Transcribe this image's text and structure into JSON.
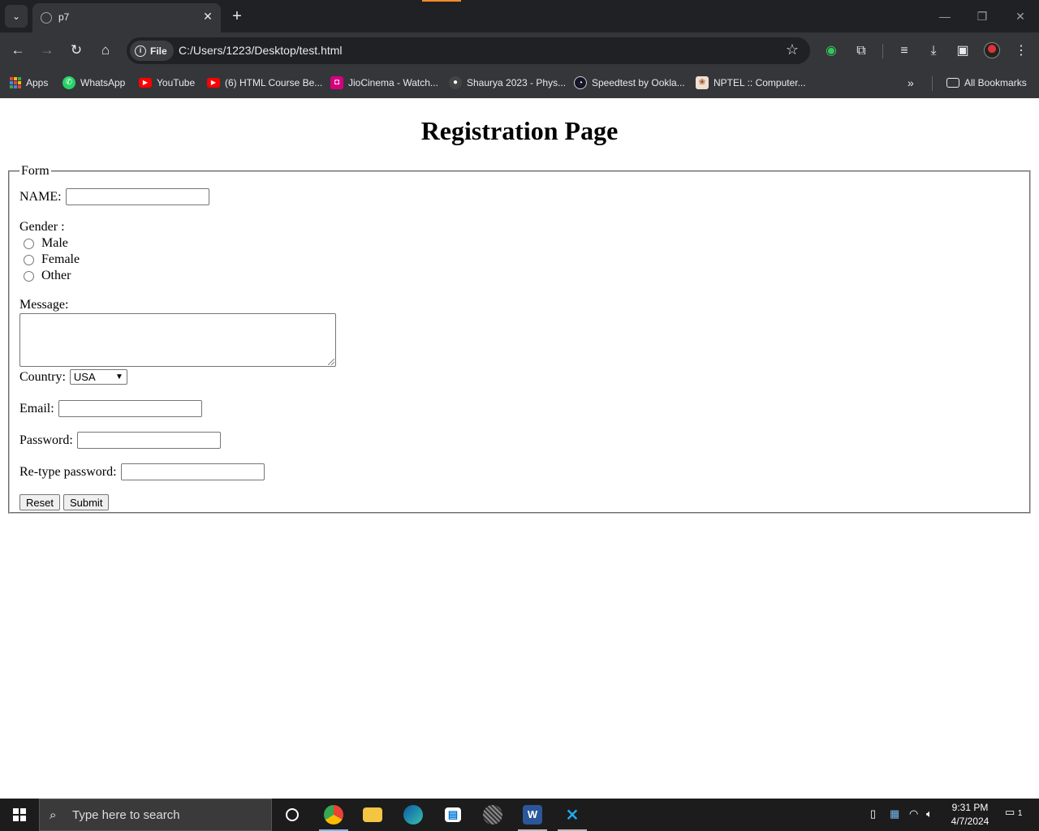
{
  "browser": {
    "tab_title": "p7",
    "address_chip": "File",
    "url": "C:/Users/1223/Desktop/test.html",
    "bookmarks": [
      {
        "label": "Apps",
        "icon": "apps-grid-icon"
      },
      {
        "label": "WhatsApp",
        "icon": "whatsapp-icon",
        "color": "#25d366"
      },
      {
        "label": "YouTube",
        "icon": "youtube-icon",
        "color": "#ff0000"
      },
      {
        "label": "(6) HTML Course Be...",
        "icon": "youtube-icon",
        "color": "#ff0000"
      },
      {
        "label": "JioCinema - Watch...",
        "icon": "jiocinema-icon",
        "color": "#d6007e"
      },
      {
        "label": "Shaurya 2023 - Phys...",
        "icon": "site-icon",
        "color": "#444444"
      },
      {
        "label": "Speedtest by Ookla...",
        "icon": "speedtest-icon",
        "color": "#141526"
      },
      {
        "label": "NPTEL :: Computer...",
        "icon": "nptel-icon",
        "color": "#f0e0d0"
      }
    ],
    "all_bookmarks": "All Bookmarks"
  },
  "page": {
    "heading": "Registration Page",
    "legend": "Form",
    "name_label": "NAME:",
    "gender_label": "Gender :",
    "gender_options": [
      "Male",
      "Female",
      "Other"
    ],
    "message_label": "Message:",
    "country_label": "Country:",
    "country_selected": "USA",
    "email_label": "Email:",
    "password_label": "Password:",
    "retype_label": "Re-type password:",
    "reset_label": "Reset",
    "submit_label": "Submit"
  },
  "taskbar": {
    "search_placeholder": "Type here to search",
    "time": "9:31 PM",
    "date": "4/7/2024",
    "notification_count": "1"
  }
}
